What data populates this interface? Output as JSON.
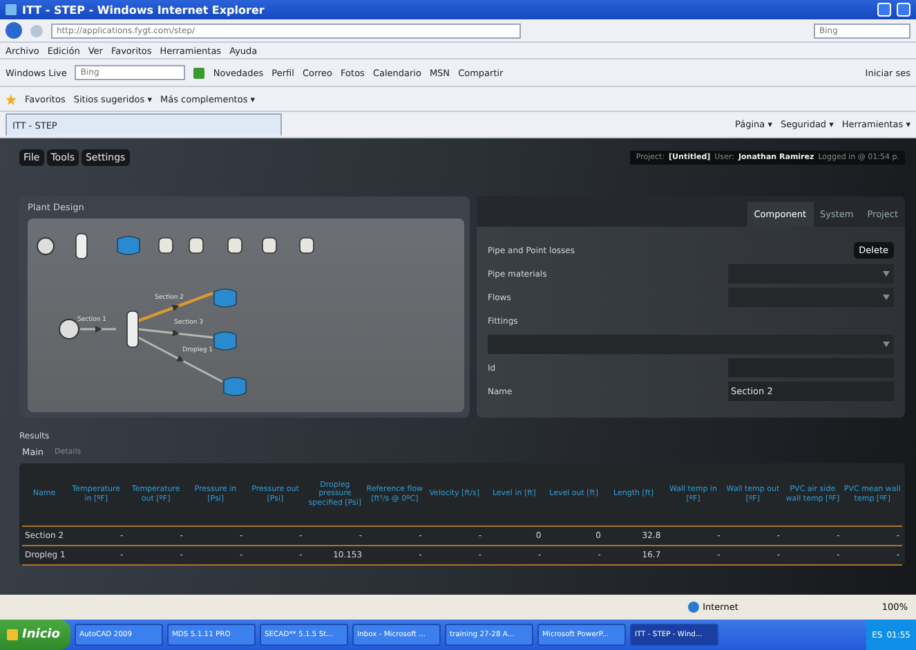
{
  "browser": {
    "title": "ITT - STEP - Windows Internet Explorer",
    "address": "http://applications.fygt.com/step/",
    "search_placeholder": "Bing",
    "menu": [
      "Archivo",
      "Edición",
      "Ver",
      "Favoritos",
      "Herramientas",
      "Ayuda"
    ],
    "live_toolbar": {
      "brand": "Windows Live",
      "search_placeholder": "Bing",
      "links": [
        "Novedades",
        "Perfil",
        "Correo",
        "Fotos",
        "Calendario",
        "MSN",
        "Compartir"
      ],
      "signin": "Iniciar ses"
    },
    "favorites": {
      "label": "Favoritos",
      "items": [
        "Sitios sugeridos ▾",
        "Más complementos ▾"
      ]
    },
    "tab": "ITT - STEP",
    "commands": [
      "Página ▾",
      "Seguridad ▾",
      "Herramientas ▾"
    ]
  },
  "app": {
    "menu": [
      "File",
      "Tools",
      "Settings"
    ],
    "session": {
      "project_label": "Project:",
      "project": "[Untitled]",
      "user_label": "User:",
      "user": "Jonathan Ramirez",
      "logged": "Logged in @ 01:54 p."
    }
  },
  "plant_design": {
    "title": "Plant Design",
    "edges": [
      {
        "label": "Section 1",
        "selected": false
      },
      {
        "label": "Section 2",
        "selected": true
      },
      {
        "label": "Section 3",
        "selected": false
      },
      {
        "label": "Dropleg 1",
        "selected": false
      }
    ]
  },
  "component_panel": {
    "tabs": [
      {
        "label": "Component",
        "selected": true
      },
      {
        "label": "System",
        "selected": false
      },
      {
        "label": "Project",
        "selected": false
      }
    ],
    "section_title": "Pipe and Point losses",
    "delete": "Delete",
    "fields": [
      {
        "kind": "dropdown",
        "label": "Pipe materials"
      },
      {
        "kind": "dropdown",
        "label": "Flows"
      },
      {
        "kind": "wide-dropdown",
        "label": "Fittings"
      },
      {
        "kind": "text",
        "label": "Id"
      },
      {
        "kind": "text",
        "label": "Name",
        "value": "Section 2"
      }
    ]
  },
  "results": {
    "title": "Results",
    "tabs": [
      {
        "label": "Main",
        "selected": true
      },
      {
        "label": "Details",
        "selected": false
      }
    ],
    "columns": [
      "Name",
      "Temperature in [ºF]",
      "Temperature out [ºF]",
      "Pressure in [Psi]",
      "Pressure out [Psi]",
      "Dropleg pressure specified [Psi]",
      "Reference flow [ft³/s @ 0ºC]",
      "Velocity [ft/s]",
      "Level in [ft]",
      "Level out [ft]",
      "Length [ft]",
      "Wall temp in [ºF]",
      "Wall temp out [ºF]",
      "PVC air side wall temp [ºF]",
      "PVC mean wall temp [ºF]"
    ],
    "rows": [
      [
        "Section 2",
        "-",
        "-",
        "-",
        "-",
        "-",
        "-",
        "-",
        "0",
        "0",
        "32.8",
        "-",
        "-",
        "-",
        "-"
      ],
      [
        "Dropleg 1",
        "-",
        "-",
        "-",
        "-",
        "10.153",
        "-",
        "-",
        "-",
        "-",
        "16.7",
        "-",
        "-",
        "-",
        "-"
      ]
    ]
  },
  "status": {
    "zone": "Internet",
    "zoom": "100%"
  },
  "taskbar": {
    "start": "Inicio",
    "items": [
      {
        "label": "AutoCAD 2009",
        "selected": false
      },
      {
        "label": "MDS 5.1.11 PRO",
        "selected": false
      },
      {
        "label": "SECAD** 5.1.5 St...",
        "selected": false
      },
      {
        "label": "Inbox - Microsoft ...",
        "selected": false
      },
      {
        "label": "training 27-28 A...",
        "selected": false
      },
      {
        "label": "Microsoft PowerP...",
        "selected": false
      },
      {
        "label": "ITT - STEP - Wind...",
        "selected": true
      }
    ],
    "lang": "ES",
    "clock": "01:55"
  }
}
